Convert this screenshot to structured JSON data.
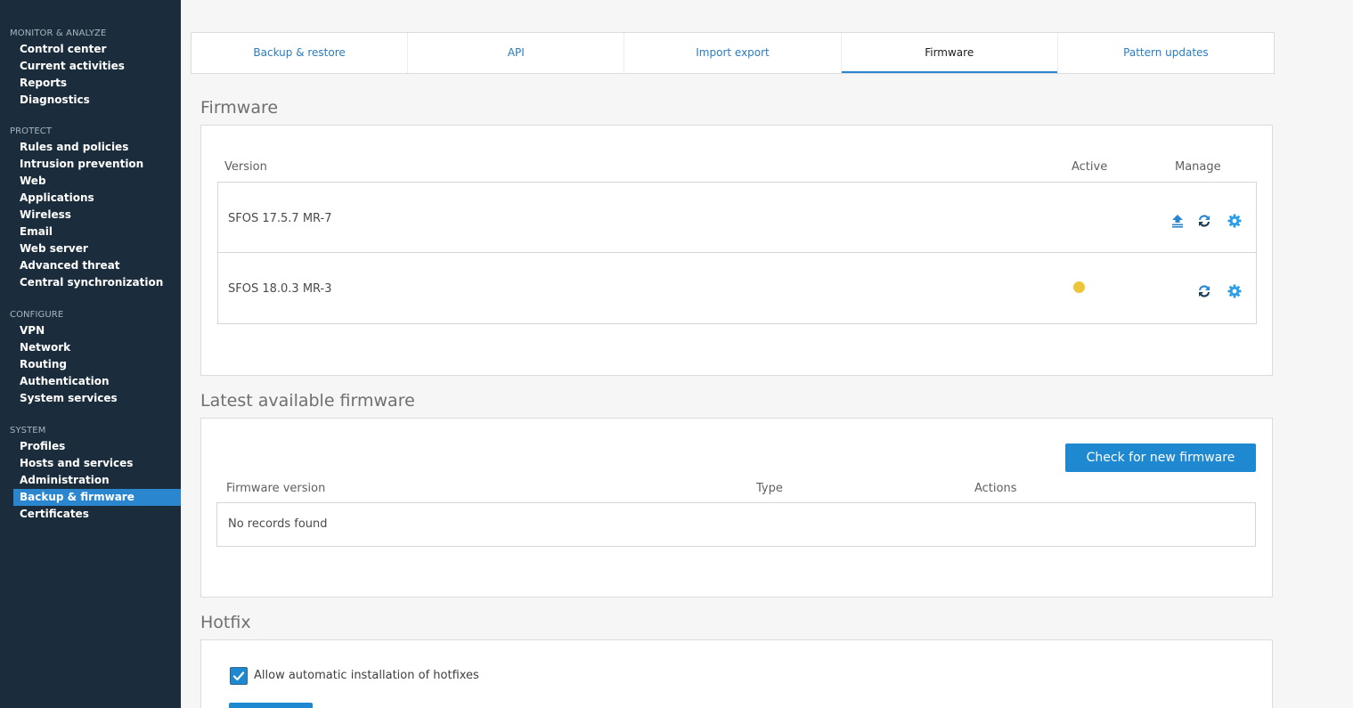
{
  "sidebar": {
    "groups": [
      {
        "title": "MONITOR & ANALYZE",
        "items": [
          "Control center",
          "Current activities",
          "Reports",
          "Diagnostics"
        ]
      },
      {
        "title": "PROTECT",
        "items": [
          "Rules and policies",
          "Intrusion prevention",
          "Web",
          "Applications",
          "Wireless",
          "Email",
          "Web server",
          "Advanced threat",
          "Central synchronization"
        ]
      },
      {
        "title": "CONFIGURE",
        "items": [
          "VPN",
          "Network",
          "Routing",
          "Authentication",
          "System services"
        ]
      },
      {
        "title": "SYSTEM",
        "items": [
          "Profiles",
          "Hosts and services",
          "Administration",
          "Backup & firmware",
          "Certificates"
        ]
      }
    ],
    "active_item": "Backup & firmware"
  },
  "tabs": [
    {
      "label": "Backup & restore"
    },
    {
      "label": "API"
    },
    {
      "label": "Import export"
    },
    {
      "label": "Firmware",
      "active": true
    },
    {
      "label": "Pattern updates"
    }
  ],
  "firmware": {
    "title": "Firmware",
    "columns": {
      "version": "Version",
      "active": "Active",
      "manage": "Manage"
    },
    "rows": [
      {
        "version": "SFOS 17.5.7 MR-7",
        "active": false,
        "icons": [
          "boot-upload-icon",
          "swap-icon",
          "gear-icon"
        ]
      },
      {
        "version": "SFOS 18.0.3 MR-3",
        "active": true,
        "icons": [
          "swap-icon",
          "gear-icon"
        ]
      }
    ],
    "active_color": "#eec53a"
  },
  "latest": {
    "title": "Latest available firmware",
    "button": "Check for new firmware",
    "columns": {
      "version": "Firmware version",
      "type": "Type",
      "actions": "Actions"
    },
    "empty_text": "No records found"
  },
  "hotfix": {
    "title": "Hotfix",
    "checkbox_label": "Allow automatic installation of hotfixes",
    "checked": true
  },
  "colors": {
    "sidebar_bg": "#1b2d3c",
    "accent": "#2a87cf",
    "button": "#1e88d0"
  }
}
